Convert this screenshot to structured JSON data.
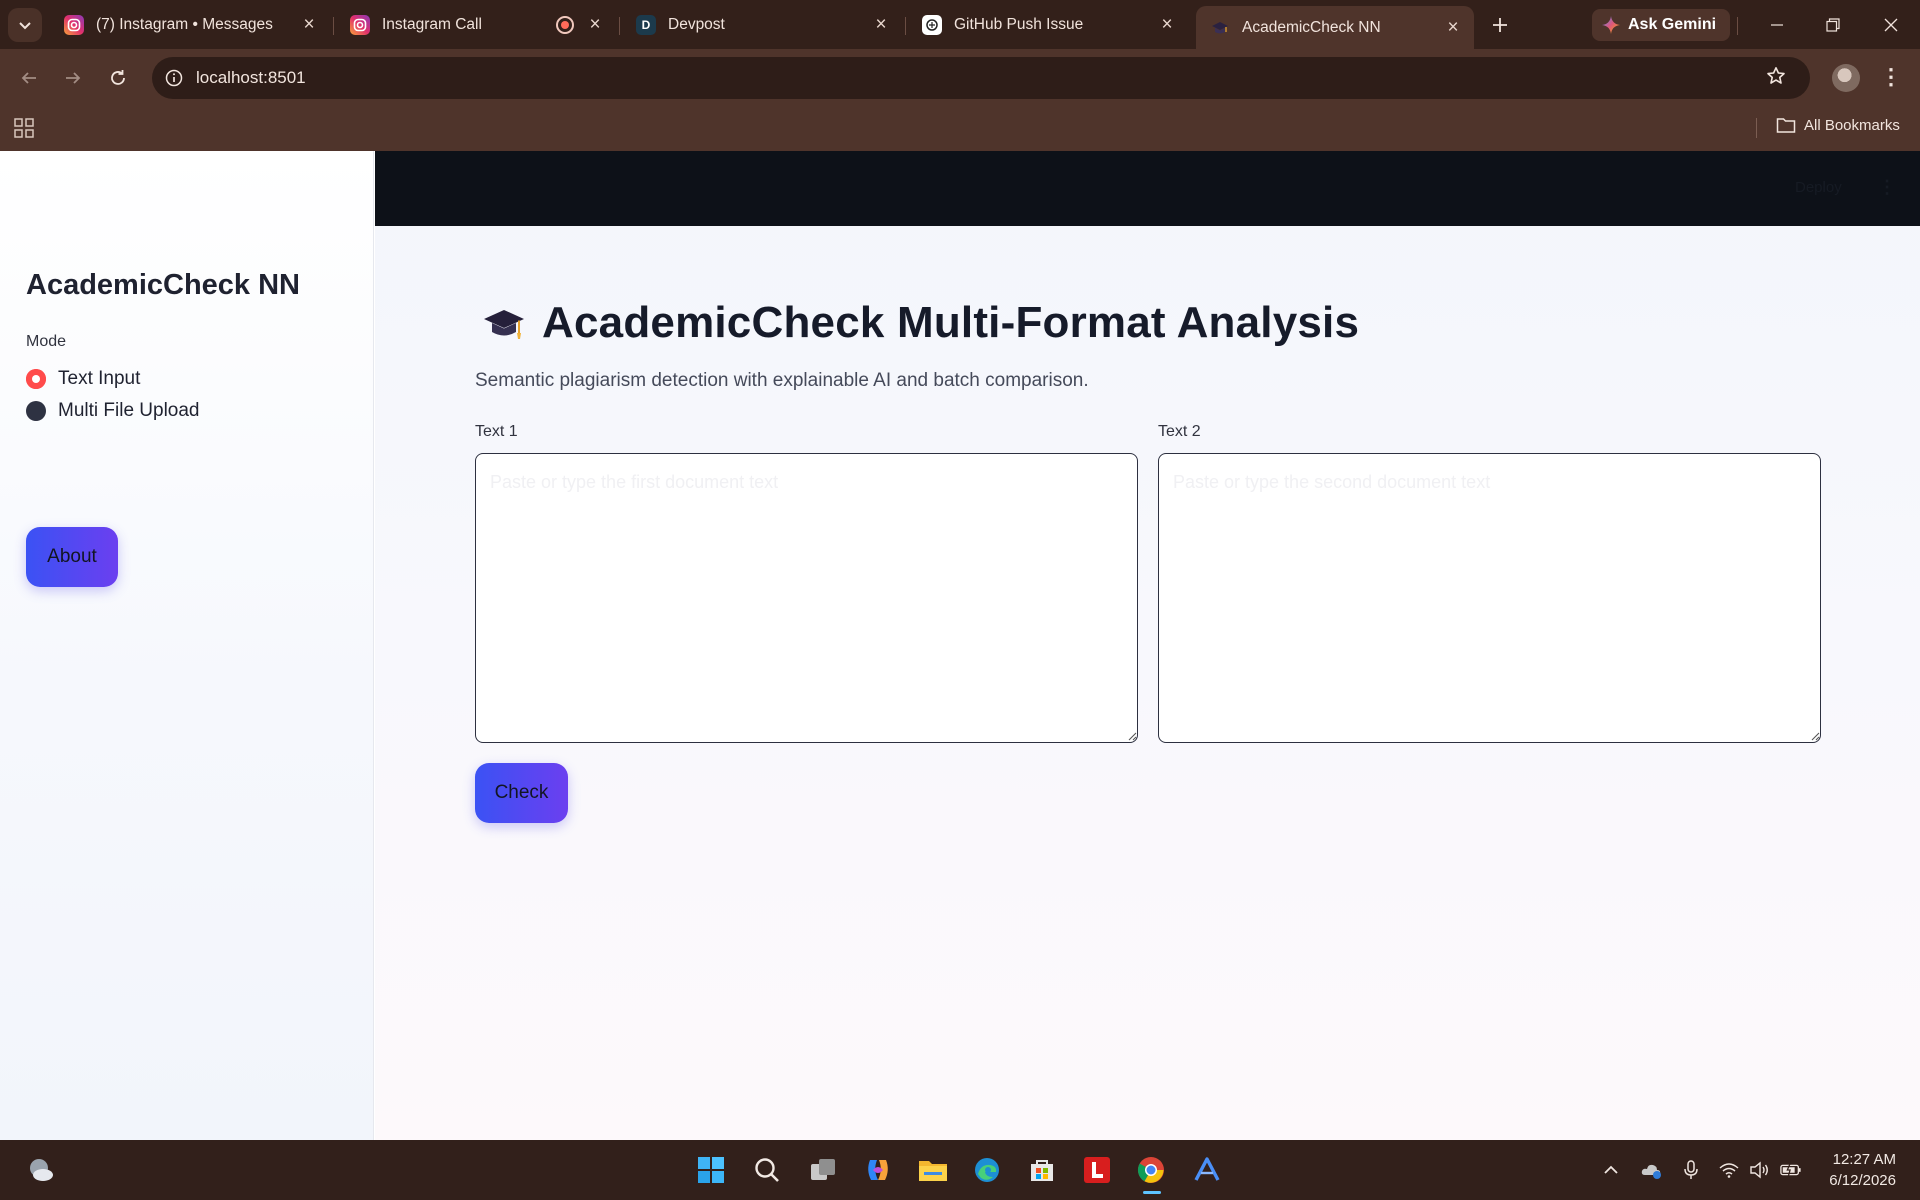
{
  "browser": {
    "tabs": [
      {
        "title": "(7) Instagram • Messages",
        "icon": "instagram-icon"
      },
      {
        "title": "Instagram Call",
        "icon": "instagram-icon"
      },
      {
        "title": "Devpost",
        "icon": "devpost-icon",
        "icon_letter": "D"
      },
      {
        "title": "GitHub Push Issue",
        "icon": "chatgpt-icon"
      },
      {
        "title": "AcademicCheck NN",
        "icon": "graduation-cap-icon",
        "active": true
      }
    ],
    "ask_gemini_label": "Ask Gemini",
    "url": "localhost:8501",
    "all_bookmarks_label": "All Bookmarks"
  },
  "sidebar": {
    "title": "AcademicCheck NN",
    "mode_label": "Mode",
    "mode_options": [
      "Text Input",
      "Multi File Upload"
    ],
    "selected_mode": "Text Input",
    "about_label": "About"
  },
  "header": {
    "deploy_label": "Deploy",
    "menu_glyph": "⋮"
  },
  "main": {
    "title_icon": "🎓",
    "title": "AcademicCheck Multi-Format Analysis",
    "subtitle": "Semantic plagiarism detection with explainable AI and batch comparison.",
    "text1_label": "Text 1",
    "text1_placeholder": "Paste or type the first document text",
    "text1_value": "",
    "text2_label": "Text 2",
    "text2_placeholder": "Paste or type the second document text",
    "text2_value": "",
    "check_label": "Check"
  },
  "taskbar": {
    "time": "12:27 AM",
    "date": "6/12/2026"
  },
  "colors": {
    "accent_red": "#ff4b4b",
    "button_gradient_start": "#3b52f4",
    "button_gradient_end": "#6b3ff0",
    "chrome_dark": "#33201a",
    "chrome_toolbar": "#4f342b"
  }
}
